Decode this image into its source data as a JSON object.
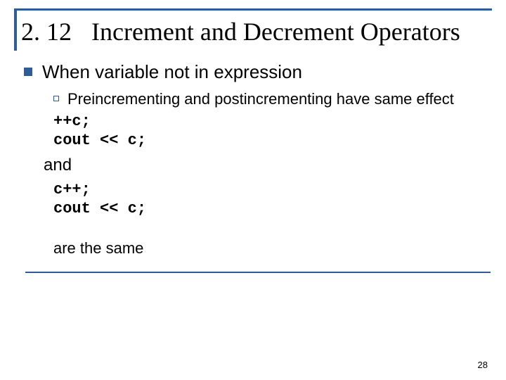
{
  "title": {
    "number": "2. 12",
    "text": "Increment and Decrement Operators"
  },
  "body": {
    "level1": "When variable not in expression",
    "level2": "Preincrementing and postincrementing have same effect",
    "code1": "++c;\ncout << c;",
    "and": "and",
    "code2": "c++;\ncout << c;",
    "same": "are the same"
  },
  "page_number": "28"
}
